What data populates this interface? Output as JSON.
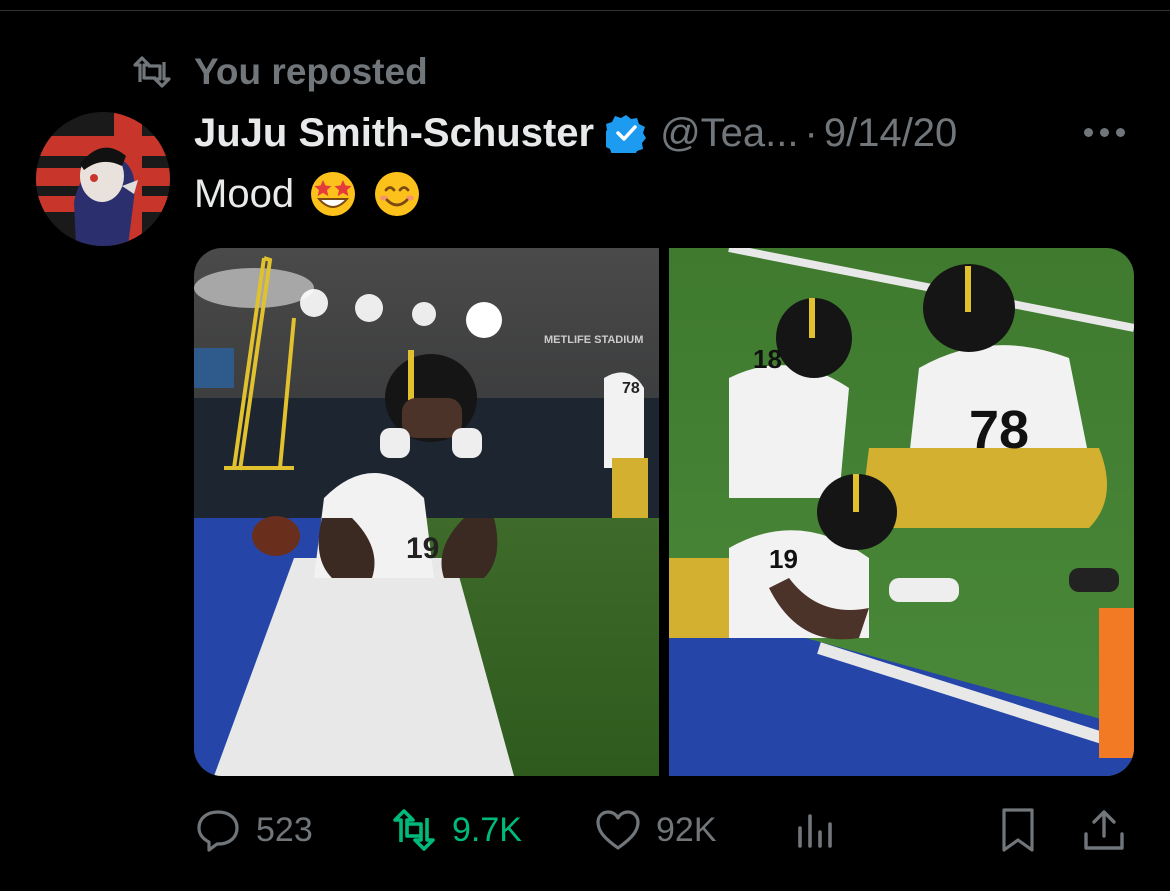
{
  "repost_label": "You reposted",
  "author": {
    "name": "JuJu Smith-Schuster",
    "handle": "@Tea...",
    "separator": "·",
    "date": "9/14/20",
    "verified": true
  },
  "tweet": {
    "text": "Mood",
    "emojis": [
      "star-struck",
      "smiling-face"
    ]
  },
  "media": {
    "left_image_caption": "METLIFE STADIUM",
    "jerseys": [
      "19",
      "78",
      "18",
      "78"
    ]
  },
  "actions": {
    "reply_count": "523",
    "repost_count": "9.7K",
    "like_count": "92K"
  },
  "colors": {
    "background": "#000000",
    "text_primary": "#e7e9ea",
    "text_secondary": "#71767b",
    "repost_active": "#00ba7c",
    "verified": "#1d9bf0"
  },
  "icons": [
    "repost-icon",
    "verified-badge-icon",
    "more-icon",
    "reply-icon",
    "like-icon",
    "views-icon",
    "bookmark-icon",
    "share-icon"
  ]
}
